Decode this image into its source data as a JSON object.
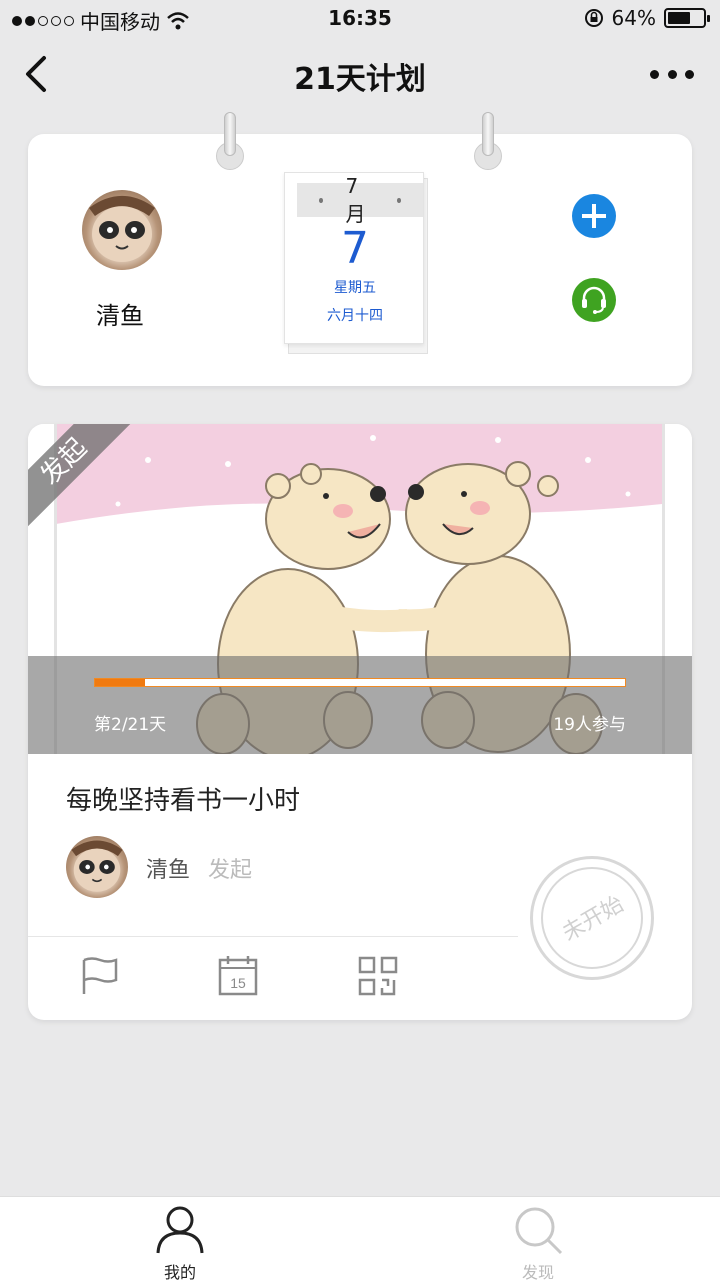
{
  "status_bar": {
    "carrier": "中国移动",
    "time": "16:35",
    "battery": "64%",
    "battery_level": 0.64
  },
  "nav": {
    "title": "21天计划"
  },
  "profile": {
    "name": "清鱼"
  },
  "calendar": {
    "month": "7月",
    "day": "7",
    "weekday": "星期五",
    "lunar": "六月十四"
  },
  "plan": {
    "ribbon": "发起",
    "progress_fraction": 0.095,
    "day_count": "第2/21天",
    "participants": "19人参与",
    "title": "每晚坚持看书一小时",
    "creator_name": "清鱼",
    "creator_role": "发起",
    "stamp": "未开始"
  },
  "tabs": [
    {
      "label": "我的",
      "active": true
    },
    {
      "label": "发现",
      "active": false
    }
  ],
  "colors": {
    "accent_blue": "#1a86e0",
    "service_green": "#3fa321",
    "progress_orange": "#f07a10",
    "calendar_blue": "#1d5bd0"
  }
}
